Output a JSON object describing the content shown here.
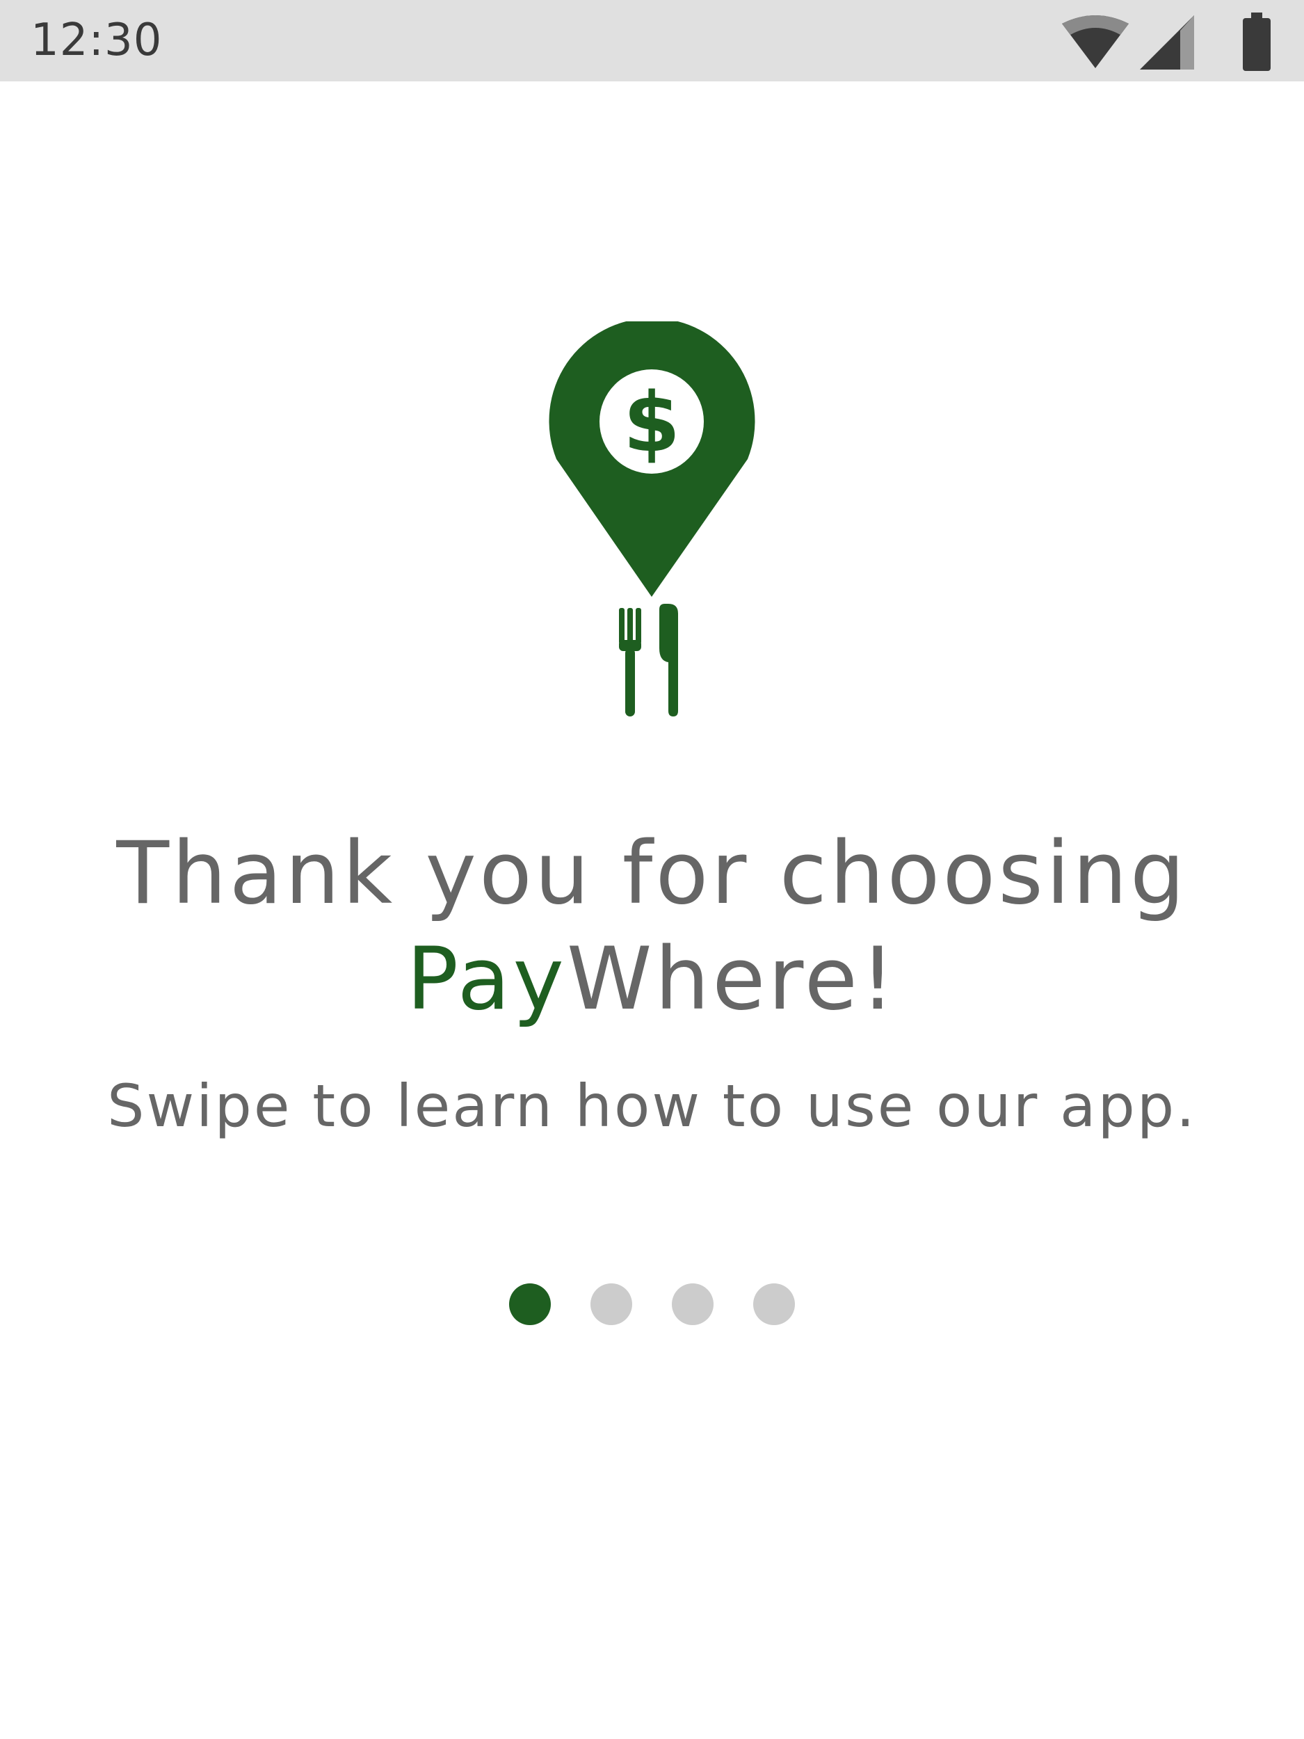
{
  "status_bar": {
    "time": "12:30",
    "icons": [
      "wifi-icon",
      "cellular-signal-icon",
      "battery-icon"
    ]
  },
  "logo": {
    "icon": "paywhere-logo-icon",
    "color": "#1e5e20"
  },
  "onboarding": {
    "title_prefix": "Thank you for choosing",
    "brand_highlight": "Pay",
    "brand_rest": "Where!",
    "subtitle": "Swipe to learn how to use our app.",
    "page_count": 4,
    "current_page": 1
  },
  "colors": {
    "accent": "#1e5e20",
    "text": "#666666",
    "dot_inactive": "#cccccc",
    "status_bar_bg": "#e0e0e0"
  }
}
